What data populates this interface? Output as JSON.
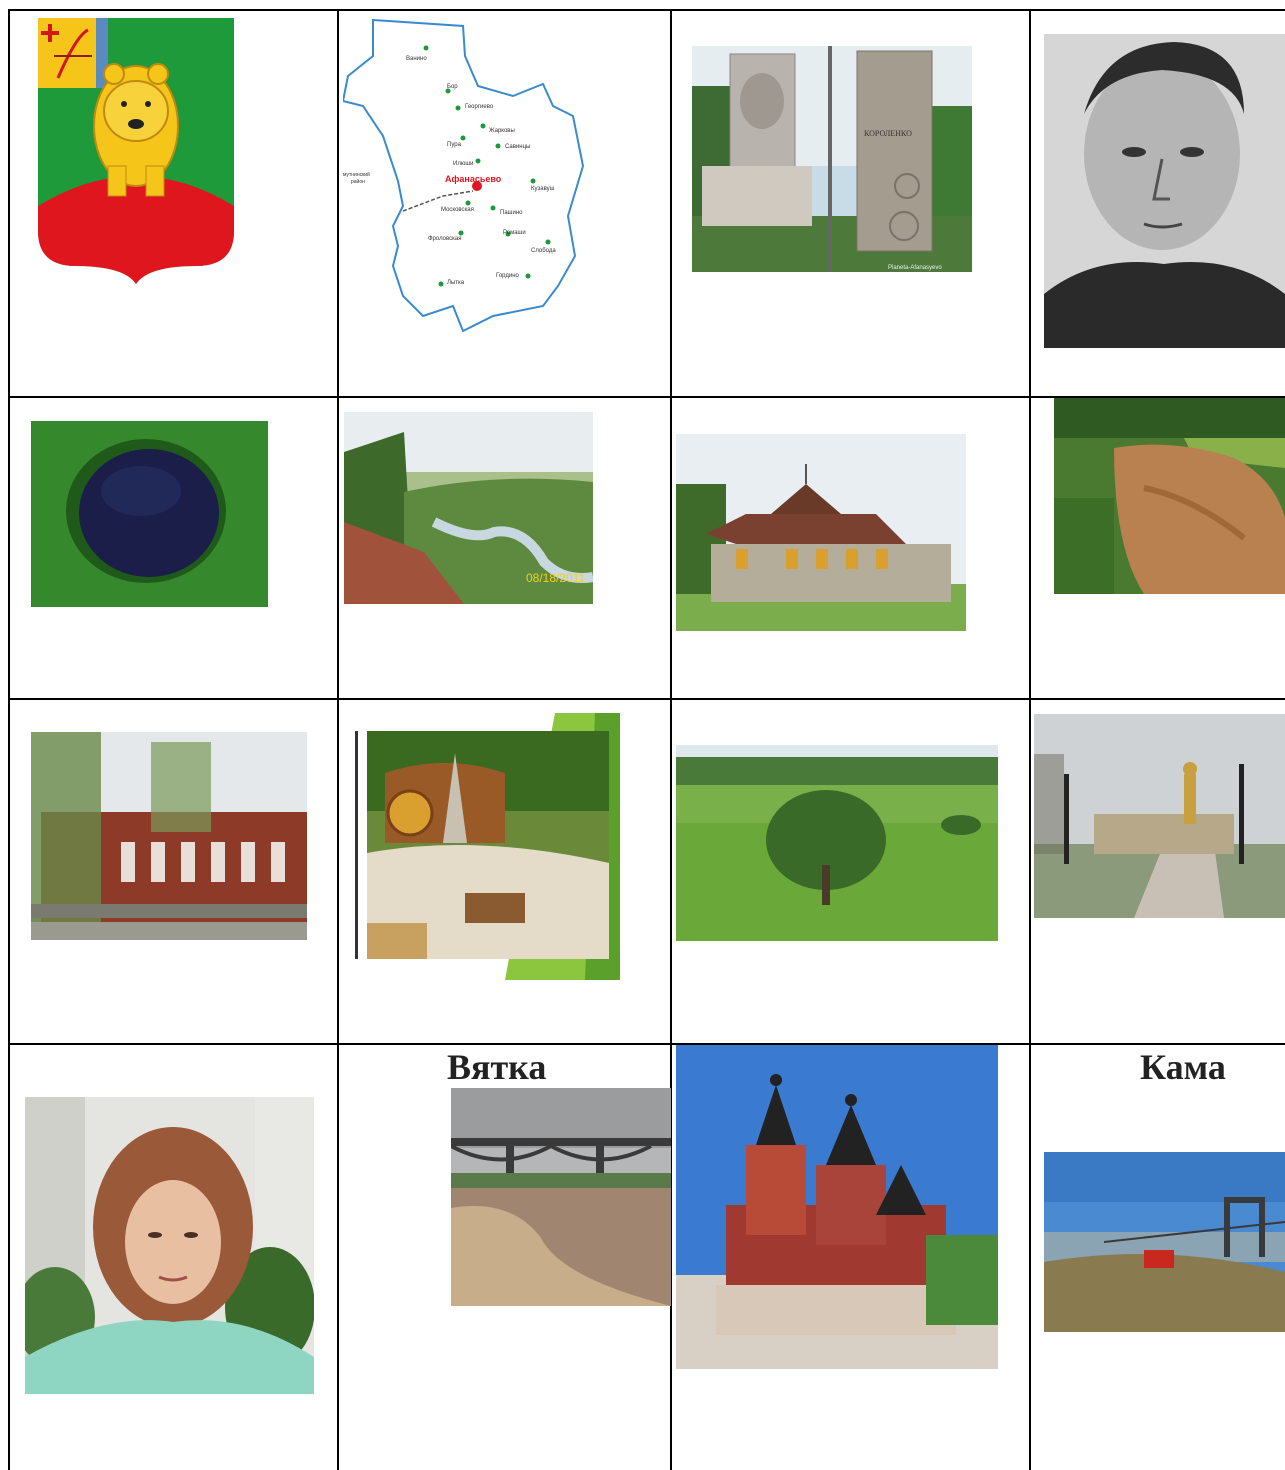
{
  "captions": {
    "vyatka": "Вятка",
    "kama": "Кама"
  },
  "map": {
    "center_label": "Афанасьево",
    "district_label_1": "мутнинский",
    "district_label_2": "район",
    "settlements": [
      "Ванино",
      "Бор",
      "Георгиево",
      "Жарковы",
      "Пура",
      "Савинцы",
      "Илюши",
      "Кузавуш",
      "Московская",
      "Пашино",
      "Ромаши",
      "Фроловская",
      "Слобода",
      "Гордино",
      "Лытка"
    ]
  },
  "monument": {
    "name_text": "КОРОЛЕНКО",
    "watermark": "Planeta-Afanasyevo"
  },
  "river_photo": {
    "date_stamp": "08/18/2011"
  },
  "colors": {
    "coat_green": "#1e9a3a",
    "coat_red": "#e0161e",
    "bear_yellow": "#f6c51a",
    "table_border": "#000000"
  }
}
